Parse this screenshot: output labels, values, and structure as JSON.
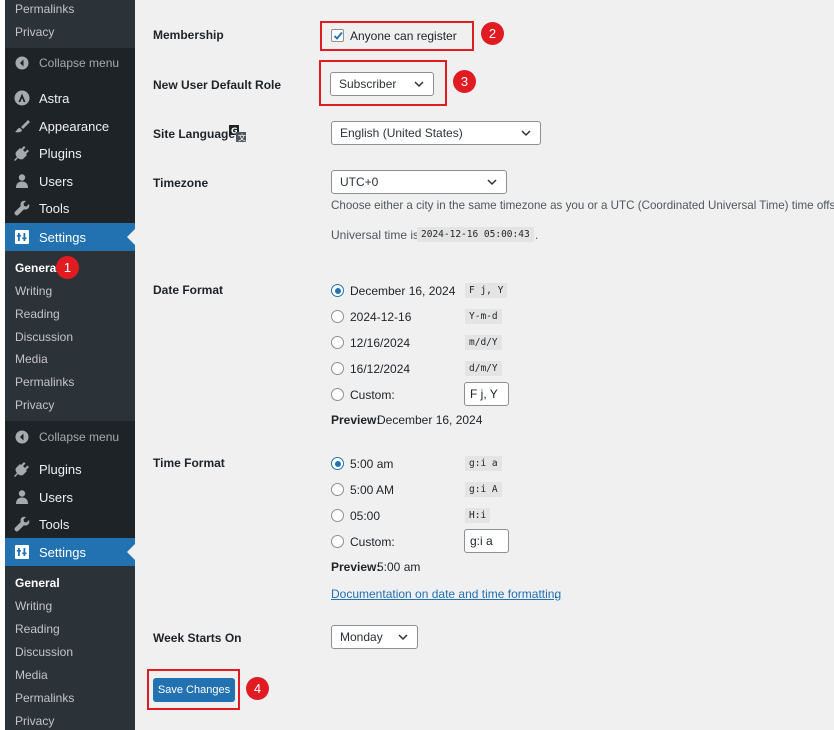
{
  "sidebar": {
    "top_submenu": [
      "Permalinks",
      "Privacy"
    ],
    "collapse_label": "Collapse menu",
    "menu_a": [
      {
        "label": "Astra",
        "icon": "astra-icon"
      },
      {
        "label": "Appearance",
        "icon": "appearance-brush-icon"
      },
      {
        "label": "Plugins",
        "icon": "plugins-icon"
      },
      {
        "label": "Users",
        "icon": "users-icon"
      },
      {
        "label": "Tools",
        "icon": "tools-wrench-icon"
      },
      {
        "label": "Settings",
        "icon": "settings-icon"
      }
    ],
    "submenu_a": [
      "General",
      "Writing",
      "Reading",
      "Discussion",
      "Media",
      "Permalinks",
      "Privacy"
    ],
    "menu_b": [
      {
        "label": "Plugins",
        "icon": "plugins-icon"
      },
      {
        "label": "Users",
        "icon": "users-icon"
      },
      {
        "label": "Tools",
        "icon": "tools-wrench-icon"
      },
      {
        "label": "Settings",
        "icon": "settings-icon"
      }
    ],
    "submenu_b": [
      "General",
      "Writing",
      "Reading",
      "Discussion",
      "Media",
      "Permalinks",
      "Privacy"
    ]
  },
  "settings": {
    "membership": {
      "label": "Membership",
      "checkbox_label": "Anyone can register",
      "checked": true
    },
    "default_role": {
      "label": "New User Default Role",
      "value": "Subscriber"
    },
    "site_language": {
      "label": "Site Language",
      "value": "English (United States)"
    },
    "timezone": {
      "label": "Timezone",
      "value": "UTC+0",
      "description": "Choose either a city in the same timezone as you or a UTC (Coordinated Universal Time) time offset.",
      "universal_prefix": "Universal time is",
      "universal_value": "2024-12-16 05:00:43",
      "universal_suffix": "."
    },
    "date_format": {
      "label": "Date Format",
      "options": [
        {
          "label": "December 16, 2024",
          "code": "F j, Y",
          "selected": true
        },
        {
          "label": "2024-12-16",
          "code": "Y-m-d",
          "selected": false
        },
        {
          "label": "12/16/2024",
          "code": "m/d/Y",
          "selected": false
        },
        {
          "label": "16/12/2024",
          "code": "d/m/Y",
          "selected": false
        }
      ],
      "custom_label": "Custom:",
      "custom_value": "F j, Y",
      "preview_label": "Preview:",
      "preview_value": "December 16, 2024"
    },
    "time_format": {
      "label": "Time Format",
      "options": [
        {
          "label": "5:00 am",
          "code": "g:i a",
          "selected": true
        },
        {
          "label": "5:00 AM",
          "code": "g:i A",
          "selected": false
        },
        {
          "label": "05:00",
          "code": "H:i",
          "selected": false
        }
      ],
      "custom_label": "Custom:",
      "custom_value": "g:i a",
      "preview_label": "Preview:",
      "preview_value": "5:00 am",
      "doc_link": "Documentation on date and time formatting",
      "doc_suffix": "."
    },
    "week_starts": {
      "label": "Week Starts On",
      "value": "Monday"
    },
    "save_label": "Save Changes"
  },
  "annotations": [
    "1",
    "2",
    "3",
    "4"
  ],
  "colors": {
    "accent": "#2271b1",
    "sidebar": "#1d2327",
    "annotation": "#e11b22"
  }
}
